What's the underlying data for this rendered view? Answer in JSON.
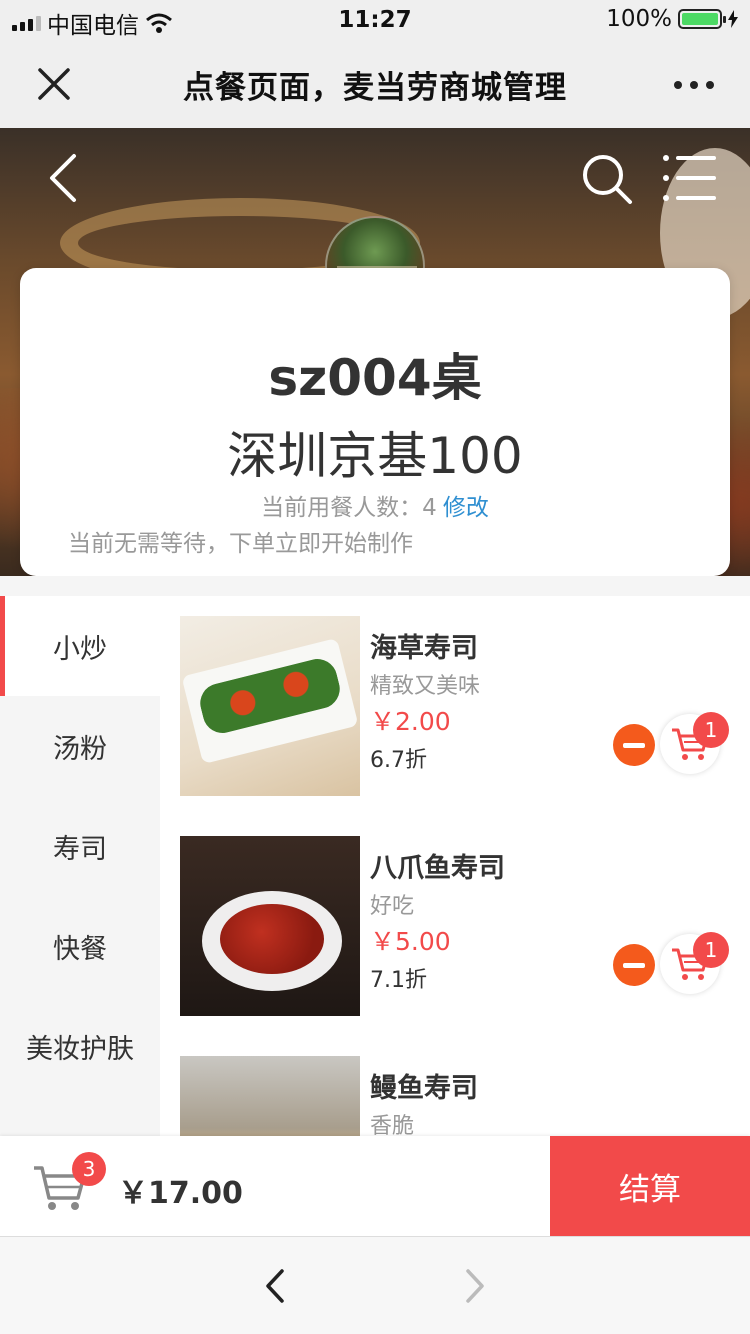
{
  "status_bar": {
    "carrier": "中国电信",
    "time": "11:27",
    "battery": "100%"
  },
  "nav": {
    "title": "点餐页面，麦当劳商城管理"
  },
  "store": {
    "table": "sz004桌",
    "name": "深圳京基100",
    "diners_label": "当前用餐人数：",
    "diners_count": "4",
    "edit_label": "修改",
    "wait_text": "当前无需等待，下单立即开始制作"
  },
  "categories": [
    "小炒",
    "汤粉",
    "寿司",
    "快餐",
    "美妆护肤"
  ],
  "dishes": [
    {
      "name": "海草寿司",
      "desc": "精致又美味",
      "price": "￥2.00",
      "discount": "6.7折",
      "qty": "1"
    },
    {
      "name": "八爪鱼寿司",
      "desc": "好吃",
      "price": "￥5.00",
      "discount": "7.1折",
      "qty": "1"
    },
    {
      "name": "鳗鱼寿司",
      "desc": "香脆"
    }
  ],
  "cart": {
    "count": "3",
    "total": "￥17.00",
    "checkout_label": "结算"
  },
  "colors": {
    "accent": "#f24a4a",
    "minus": "#f45a1c",
    "link": "#2f8fd1"
  }
}
